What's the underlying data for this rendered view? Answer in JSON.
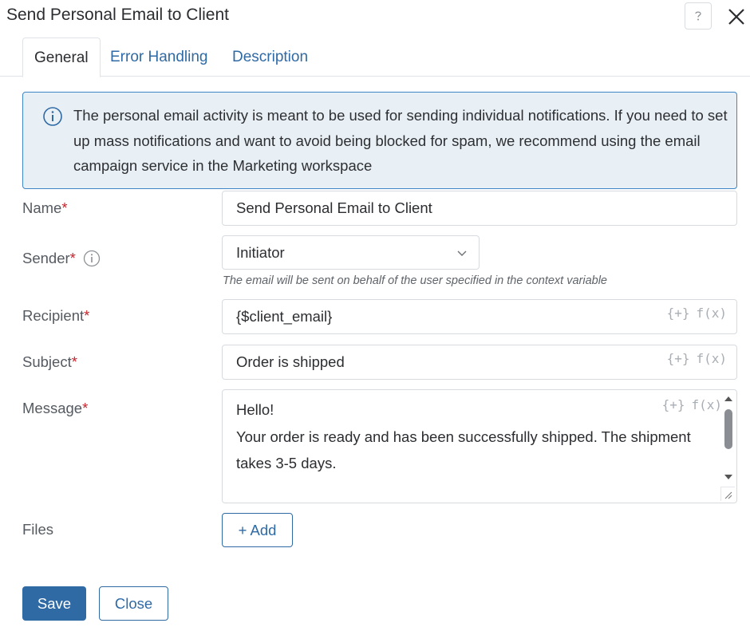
{
  "dialog": {
    "title": "Send Personal Email to Client"
  },
  "tabs": [
    {
      "label": "General",
      "active": true
    },
    {
      "label": "Error Handling",
      "active": false
    },
    {
      "label": "Description",
      "active": false
    }
  ],
  "info": {
    "text": "The personal email activity is meant to be used for sending individual notifications. If you need to set up mass notifications and want to avoid being blocked for spam, we recommend using the email campaign service in the Marketing workspace"
  },
  "form": {
    "name": {
      "label": "Name",
      "required_mark": "*",
      "value": "Send Personal Email to Client"
    },
    "sender": {
      "label": "Sender",
      "required_mark": "*",
      "value": "Initiator",
      "hint": "The email will be sent on behalf of the user specified in the context variable"
    },
    "recipient": {
      "label": "Recipient",
      "required_mark": "*",
      "value": "{$client_email}"
    },
    "subject": {
      "label": "Subject",
      "required_mark": "*",
      "value": "Order is shipped"
    },
    "message": {
      "label": "Message",
      "required_mark": "*",
      "lines": [
        "Hello!",
        "Your order is ready and has been successfully shipped. The shipment",
        "takes 3-5 days."
      ]
    },
    "files": {
      "label": "Files",
      "add_label": "+ Add"
    }
  },
  "field_tools": {
    "insert_variable": "{+}",
    "function": "f(x)"
  },
  "footer": {
    "save_label": "Save",
    "close_label": "Close"
  },
  "colors": {
    "accent": "#2f6aa5",
    "info_bg": "#e8f0f6",
    "info_border": "#3f86c7",
    "required": "#c4262e"
  },
  "icons": {
    "help": "question-icon",
    "close": "close-icon",
    "info": "info-circle-icon",
    "dropdown": "chevron-down-icon"
  }
}
